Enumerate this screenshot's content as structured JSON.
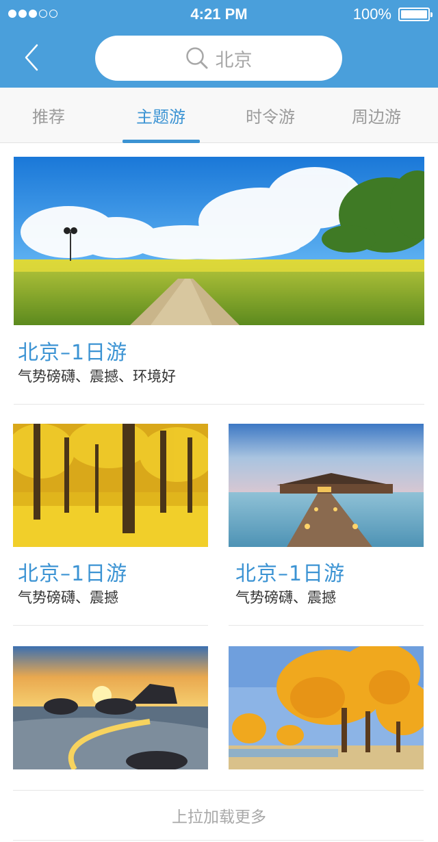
{
  "status_bar": {
    "signal_dots_filled": 3,
    "signal_dots_total": 5,
    "time": "4:21 PM",
    "battery": "100%",
    "battery_level": 1.0
  },
  "nav": {
    "back_icon": "chevron-left-icon",
    "search": {
      "icon": "search-icon",
      "value": "北京"
    }
  },
  "tabs": [
    {
      "label": "推荐",
      "active": false
    },
    {
      "label": "主题游",
      "active": true
    },
    {
      "label": "时令游",
      "active": false
    },
    {
      "label": "周边游",
      "active": false
    }
  ],
  "featured": {
    "image": "rapeseed-field-path",
    "title": "北京–1日游",
    "desc": "气势磅礴、震撼、环境好"
  },
  "grid": [
    {
      "image": "ginkgo-forest",
      "title": "北京–1日游",
      "desc": "气势磅礴、震撼"
    },
    {
      "image": "overwater-bungalow",
      "title": "北京–1日游",
      "desc": "气势磅礴、震撼"
    },
    {
      "image": "beach-sunset-rocks",
      "title": "",
      "desc": ""
    },
    {
      "image": "autumn-poplar-trees",
      "title": "",
      "desc": ""
    }
  ],
  "footer": {
    "load_more": "上拉加载更多"
  },
  "colors": {
    "header": "#4a9fdb",
    "accent": "#3b93d3",
    "tab_inactive": "#9b9b9b"
  }
}
